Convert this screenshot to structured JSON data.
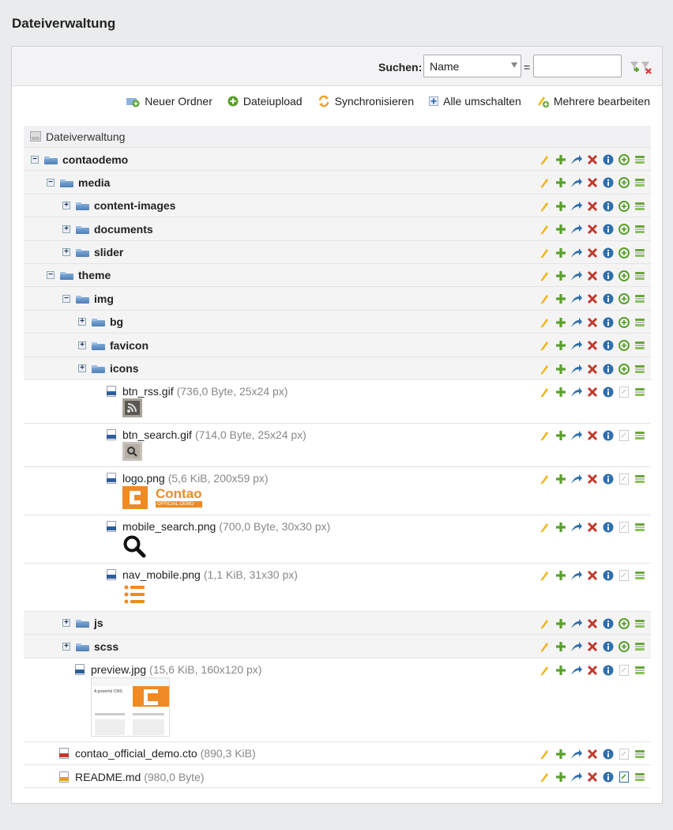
{
  "page": {
    "title": "Dateiverwaltung"
  },
  "filter": {
    "search_label": "Suchen:",
    "field_value": "Name",
    "equals": "=",
    "search_value": ""
  },
  "actions": [
    {
      "label": "Neuer Ordner",
      "icon": "new-folder-icon"
    },
    {
      "label": "Dateiupload",
      "icon": "upload-icon"
    },
    {
      "label": "Synchronisieren",
      "icon": "sync-icon"
    },
    {
      "label": "Alle umschalten",
      "icon": "toggle-all-icon"
    },
    {
      "label": "Mehrere bearbeiten",
      "icon": "edit-multiple-icon"
    }
  ],
  "tree": {
    "root_label": "Dateiverwaltung",
    "rows": [
      {
        "type": "folder",
        "name": "contaodemo",
        "toggle": "−"
      },
      {
        "type": "folder",
        "name": "media",
        "toggle": "−"
      },
      {
        "type": "folder",
        "name": "content-images",
        "toggle": "+"
      },
      {
        "type": "folder",
        "name": "documents",
        "toggle": "+"
      },
      {
        "type": "folder",
        "name": "slider",
        "toggle": "+"
      },
      {
        "type": "folder",
        "name": "theme",
        "toggle": "−"
      },
      {
        "type": "folder",
        "name": "img",
        "toggle": "−"
      },
      {
        "type": "folder",
        "name": "bg",
        "toggle": "+"
      },
      {
        "type": "folder",
        "name": "favicon",
        "toggle": "+"
      },
      {
        "type": "folder",
        "name": "icons",
        "toggle": "+"
      },
      {
        "type": "file",
        "name": "btn_rss.gif",
        "meta": "(736,0 Byte, 25x24 px)",
        "ext": "GIF"
      },
      {
        "type": "file",
        "name": "btn_search.gif",
        "meta": "(714,0 Byte, 25x24 px)",
        "ext": "GIF"
      },
      {
        "type": "file",
        "name": "logo.png",
        "meta": "(5,6 KiB, 200x59 px)",
        "ext": "PNG"
      },
      {
        "type": "file",
        "name": "mobile_search.png",
        "meta": "(700,0 Byte, 30x30 px)",
        "ext": "PNG"
      },
      {
        "type": "file",
        "name": "nav_mobile.png",
        "meta": "(1,1 KiB, 31x30 px)",
        "ext": "PNG"
      },
      {
        "type": "folder",
        "name": "js",
        "toggle": "+"
      },
      {
        "type": "folder",
        "name": "scss",
        "toggle": "+"
      },
      {
        "type": "file",
        "name": "preview.jpg",
        "meta": "(15,6 KiB, 160x120 px)",
        "ext": "JPG"
      },
      {
        "type": "file",
        "name": "contao_official_demo.cto",
        "meta": "(890,3 KiB)",
        "ext": "CTO"
      },
      {
        "type": "file",
        "name": "README.md",
        "meta": "(980,0 Byte)",
        "ext": "MD"
      }
    ]
  },
  "thumbs": {
    "logo_text": "Contao",
    "logo_sub": "OFFICIAL DEMO",
    "preview_text": "A powerful CMS"
  },
  "colors": {
    "accent_orange": "#f08a24",
    "green": "#5aa02c",
    "blue": "#2f6fab",
    "red": "#c0392b"
  }
}
